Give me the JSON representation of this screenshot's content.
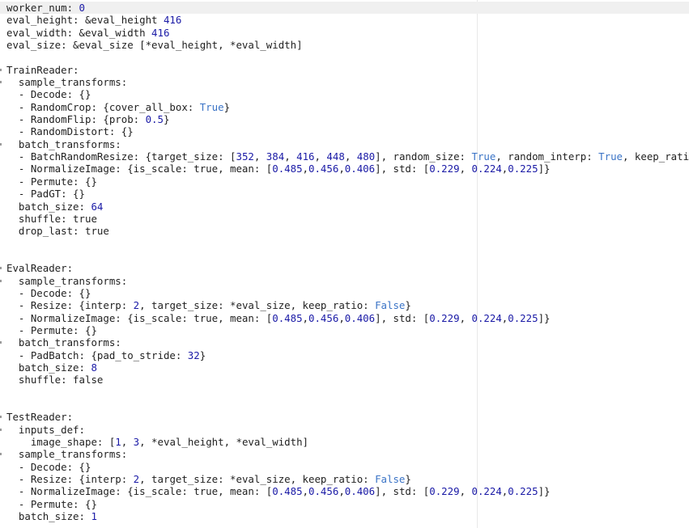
{
  "editor": {
    "lines": [
      {
        "indent": "",
        "segs": [
          {
            "t": "worker_num: "
          },
          {
            "t": "0",
            "c": "num"
          }
        ],
        "current": true
      },
      {
        "indent": "",
        "segs": [
          {
            "t": "eval_height: &eval_height "
          },
          {
            "t": "416",
            "c": "num"
          }
        ]
      },
      {
        "indent": "",
        "segs": [
          {
            "t": "eval_width: &eval_width "
          },
          {
            "t": "416",
            "c": "num"
          }
        ]
      },
      {
        "indent": "",
        "segs": [
          {
            "t": "eval_size: &eval_size [*eval_height, *eval_width]"
          }
        ]
      },
      {
        "indent": "",
        "segs": []
      },
      {
        "indent": "",
        "segs": [
          {
            "t": "TrainReader:"
          }
        ],
        "fold": true
      },
      {
        "indent": "  ",
        "segs": [
          {
            "t": "sample_transforms:"
          }
        ],
        "fold": true
      },
      {
        "indent": "  ",
        "segs": [
          {
            "t": "- Decode: {}"
          }
        ]
      },
      {
        "indent": "  ",
        "segs": [
          {
            "t": "- RandomCrop: {cover_all_box: "
          },
          {
            "t": "True",
            "c": "kw"
          },
          {
            "t": "}"
          }
        ]
      },
      {
        "indent": "  ",
        "segs": [
          {
            "t": "- RandomFlip: {prob: "
          },
          {
            "t": "0.5",
            "c": "num"
          },
          {
            "t": "}"
          }
        ]
      },
      {
        "indent": "  ",
        "segs": [
          {
            "t": "- RandomDistort: {}"
          }
        ]
      },
      {
        "indent": "  ",
        "segs": [
          {
            "t": "batch_transforms:"
          }
        ],
        "fold": true
      },
      {
        "indent": "  ",
        "segs": [
          {
            "t": "- BatchRandomResize: {target_size: ["
          },
          {
            "t": "352",
            "c": "num"
          },
          {
            "t": ", "
          },
          {
            "t": "384",
            "c": "num"
          },
          {
            "t": ", "
          },
          {
            "t": "416",
            "c": "num"
          },
          {
            "t": ", "
          },
          {
            "t": "448",
            "c": "num"
          },
          {
            "t": ", "
          },
          {
            "t": "480",
            "c": "num"
          },
          {
            "t": "], random_size: "
          },
          {
            "t": "True",
            "c": "kw"
          },
          {
            "t": ", random_interp: "
          },
          {
            "t": "True",
            "c": "kw"
          },
          {
            "t": ", keep_ratio:"
          }
        ]
      },
      {
        "indent": "  ",
        "segs": [
          {
            "t": "- NormalizeImage: {is_scale: true, mean: ["
          },
          {
            "t": "0.485",
            "c": "num"
          },
          {
            "t": ","
          },
          {
            "t": "0.456",
            "c": "num"
          },
          {
            "t": ","
          },
          {
            "t": "0.406",
            "c": "num"
          },
          {
            "t": "], std: ["
          },
          {
            "t": "0.229",
            "c": "num"
          },
          {
            "t": ", "
          },
          {
            "t": "0.224",
            "c": "num"
          },
          {
            "t": ","
          },
          {
            "t": "0.225",
            "c": "num"
          },
          {
            "t": "]}"
          }
        ]
      },
      {
        "indent": "  ",
        "segs": [
          {
            "t": "- Permute: {}"
          }
        ]
      },
      {
        "indent": "  ",
        "segs": [
          {
            "t": "- PadGT: {}"
          }
        ]
      },
      {
        "indent": "  ",
        "segs": [
          {
            "t": "batch_size: "
          },
          {
            "t": "64",
            "c": "num"
          }
        ]
      },
      {
        "indent": "  ",
        "segs": [
          {
            "t": "shuffle: true"
          }
        ]
      },
      {
        "indent": "  ",
        "segs": [
          {
            "t": "drop_last: true"
          }
        ]
      },
      {
        "indent": "",
        "segs": []
      },
      {
        "indent": "",
        "segs": []
      },
      {
        "indent": "",
        "segs": [
          {
            "t": "EvalReader:"
          }
        ],
        "fold": true
      },
      {
        "indent": "  ",
        "segs": [
          {
            "t": "sample_transforms:"
          }
        ],
        "fold": true
      },
      {
        "indent": "  ",
        "segs": [
          {
            "t": "- Decode: {}"
          }
        ]
      },
      {
        "indent": "  ",
        "segs": [
          {
            "t": "- Resize: {interp: "
          },
          {
            "t": "2",
            "c": "num"
          },
          {
            "t": ", target_size: *eval_size, keep_ratio: "
          },
          {
            "t": "False",
            "c": "kw"
          },
          {
            "t": "}"
          }
        ]
      },
      {
        "indent": "  ",
        "segs": [
          {
            "t": "- NormalizeImage: {is_scale: true, mean: ["
          },
          {
            "t": "0.485",
            "c": "num"
          },
          {
            "t": ","
          },
          {
            "t": "0.456",
            "c": "num"
          },
          {
            "t": ","
          },
          {
            "t": "0.406",
            "c": "num"
          },
          {
            "t": "], std: ["
          },
          {
            "t": "0.229",
            "c": "num"
          },
          {
            "t": ", "
          },
          {
            "t": "0.224",
            "c": "num"
          },
          {
            "t": ","
          },
          {
            "t": "0.225",
            "c": "num"
          },
          {
            "t": "]}"
          }
        ]
      },
      {
        "indent": "  ",
        "segs": [
          {
            "t": "- Permute: {}"
          }
        ]
      },
      {
        "indent": "  ",
        "segs": [
          {
            "t": "batch_transforms:"
          }
        ],
        "fold": true
      },
      {
        "indent": "  ",
        "segs": [
          {
            "t": "- PadBatch: {pad_to_stride: "
          },
          {
            "t": "32",
            "c": "num"
          },
          {
            "t": "}"
          }
        ]
      },
      {
        "indent": "  ",
        "segs": [
          {
            "t": "batch_size: "
          },
          {
            "t": "8",
            "c": "num"
          }
        ]
      },
      {
        "indent": "  ",
        "segs": [
          {
            "t": "shuffle: false"
          }
        ]
      },
      {
        "indent": "",
        "segs": []
      },
      {
        "indent": "",
        "segs": []
      },
      {
        "indent": "",
        "segs": [
          {
            "t": "TestReader:"
          }
        ],
        "fold": true
      },
      {
        "indent": "  ",
        "segs": [
          {
            "t": "inputs_def:"
          }
        ],
        "fold": true
      },
      {
        "indent": "    ",
        "segs": [
          {
            "t": "image_shape: ["
          },
          {
            "t": "1",
            "c": "num"
          },
          {
            "t": ", "
          },
          {
            "t": "3",
            "c": "num"
          },
          {
            "t": ", *eval_height, *eval_width]"
          }
        ]
      },
      {
        "indent": "  ",
        "segs": [
          {
            "t": "sample_transforms:"
          }
        ],
        "fold": true
      },
      {
        "indent": "  ",
        "segs": [
          {
            "t": "- Decode: {}"
          }
        ]
      },
      {
        "indent": "  ",
        "segs": [
          {
            "t": "- Resize: {interp: "
          },
          {
            "t": "2",
            "c": "num"
          },
          {
            "t": ", target_size: *eval_size, keep_ratio: "
          },
          {
            "t": "False",
            "c": "kw"
          },
          {
            "t": "}"
          }
        ]
      },
      {
        "indent": "  ",
        "segs": [
          {
            "t": "- NormalizeImage: {is_scale: true, mean: ["
          },
          {
            "t": "0.485",
            "c": "num"
          },
          {
            "t": ","
          },
          {
            "t": "0.456",
            "c": "num"
          },
          {
            "t": ","
          },
          {
            "t": "0.406",
            "c": "num"
          },
          {
            "t": "], std: ["
          },
          {
            "t": "0.229",
            "c": "num"
          },
          {
            "t": ", "
          },
          {
            "t": "0.224",
            "c": "num"
          },
          {
            "t": ","
          },
          {
            "t": "0.225",
            "c": "num"
          },
          {
            "t": "]}"
          }
        ]
      },
      {
        "indent": "  ",
        "segs": [
          {
            "t": "- Permute: {}"
          }
        ]
      },
      {
        "indent": "  ",
        "segs": [
          {
            "t": "batch_size: "
          },
          {
            "t": "1",
            "c": "num"
          }
        ]
      }
    ]
  },
  "colors": {
    "text": "#1f1f1f",
    "number": "#1a1aa6",
    "keyword": "#3a73c6",
    "current_line": "#f0f0f0"
  }
}
